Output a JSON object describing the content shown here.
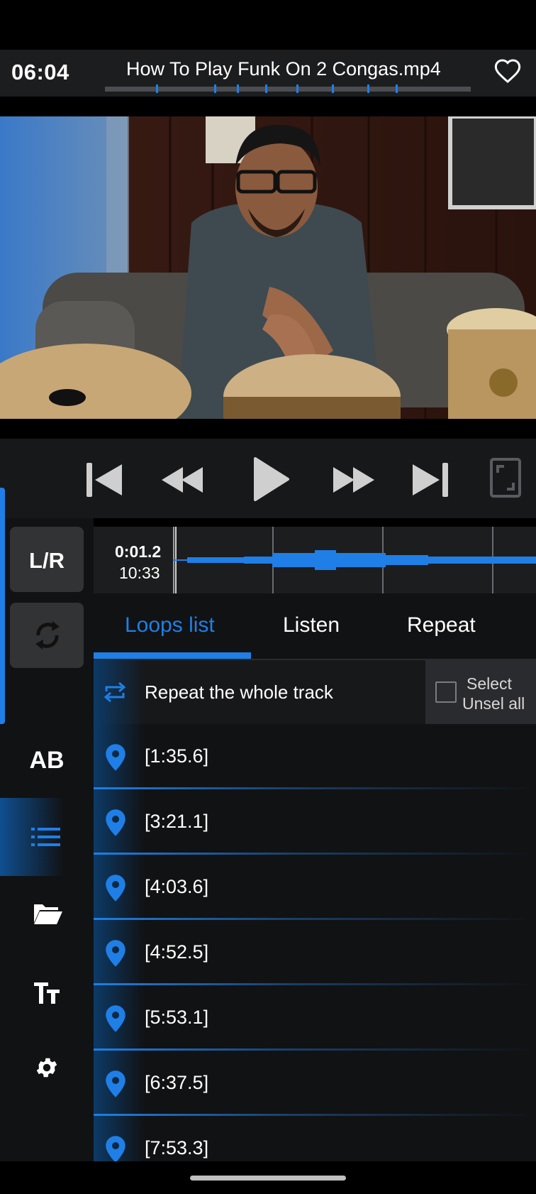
{
  "header": {
    "time": "06:04",
    "title": "How To Play Funk On 2 Congas.mp4",
    "favorite_icon": "heart-outline-icon"
  },
  "transport": {
    "buttons": [
      "skip-previous-icon",
      "rewind-icon",
      "play-icon",
      "fast-forward-icon",
      "skip-next-icon",
      "fullscreen-icon"
    ]
  },
  "rail": {
    "lr_label": "L/R",
    "ab_label": "AB",
    "icons": [
      "repeat-cycle-icon",
      "list-icon",
      "folder-open-icon",
      "text-size-icon",
      "gear-icon"
    ]
  },
  "waveform": {
    "current": "0:01.2",
    "total": "10:33"
  },
  "tabs": [
    {
      "label": "Loops list",
      "active": true
    },
    {
      "label": "Listen",
      "active": false
    },
    {
      "label": "Repeat",
      "active": false
    }
  ],
  "repeat_whole": {
    "label": "Repeat the whole track",
    "select_label": "Select",
    "unselect_label": "Unsel all"
  },
  "loops": [
    {
      "label": "[1:35.6]"
    },
    {
      "label": "[3:21.1]"
    },
    {
      "label": "[4:03.6]"
    },
    {
      "label": "[4:52.5]"
    },
    {
      "label": "[5:53.1]"
    },
    {
      "label": "[6:37.5]"
    },
    {
      "label": "[7:53.3]"
    }
  ],
  "colors": {
    "accent": "#1f7fe6",
    "background": "#111214",
    "panel": "#1c1d1f"
  }
}
